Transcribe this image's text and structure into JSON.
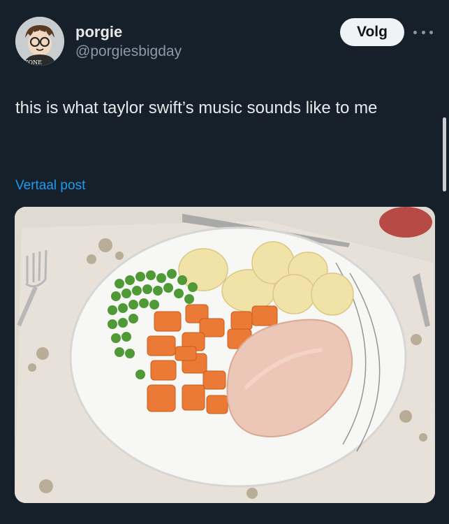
{
  "user": {
    "display_name": "porgie",
    "handle": "@porgiesbigday",
    "avatar_label": "ZONE"
  },
  "actions": {
    "follow_label": "Volg"
  },
  "post": {
    "text": "this is what taylor swift’s music sounds like to me",
    "translate_label": "Vertaal post"
  },
  "colors": {
    "background": "#15202b",
    "link": "#1d9bf0",
    "follow_button": "#eff3f4"
  },
  "icons": {
    "more": "more-horizontal-icon"
  }
}
